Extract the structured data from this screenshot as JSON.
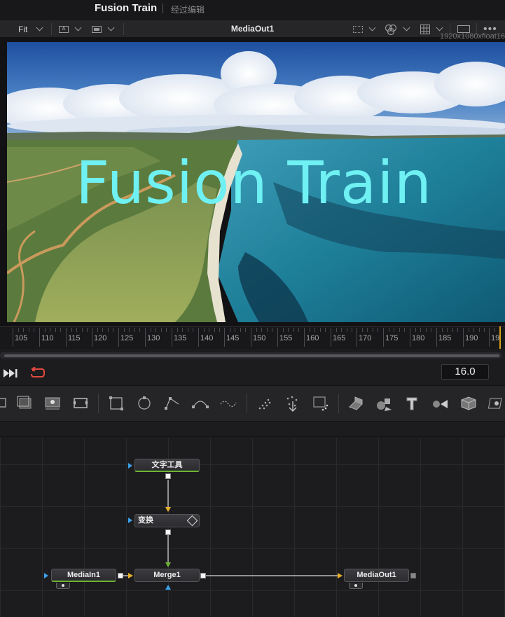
{
  "app": {
    "title": "Fusion Train",
    "subtitle": "经过编辑"
  },
  "viewer": {
    "zoom_label": "Fit",
    "title": "MediaOut1",
    "resolution": "1920x1080xfloat16",
    "overlay_text": "Fusion Train",
    "overlay_color": "#6ff0f2"
  },
  "timeline": {
    "tick_labels": [
      "105",
      "110",
      "115",
      "120",
      "125",
      "130",
      "135",
      "140",
      "145",
      "150",
      "155",
      "160",
      "165",
      "170",
      "175",
      "180",
      "185",
      "190",
      "19"
    ],
    "current_frame": "16.0",
    "playhead_color": "#d7a21c"
  },
  "toolbar": {
    "tools": [
      "merge-tool",
      "media-in-tool",
      "loader-tool",
      "transform-tool",
      "rectangle-mask-icon",
      "ellipse-mask-icon",
      "polygon-mask-icon",
      "bspline-mask-icon",
      "paint-icon",
      "particle-emitter-icon",
      "particle-render-icon",
      "particle-flow-icon",
      "shape-3d-icon",
      "merge-3d-icon",
      "text-3d-icon",
      "camera-3d-icon",
      "renderer-3d-icon",
      "image-plane-3d-icon"
    ]
  },
  "nodes": {
    "text": {
      "label": "文字工具"
    },
    "transform": {
      "label": "变换"
    },
    "mediain": {
      "label": "MediaIn1"
    },
    "merge": {
      "label": "Merge1"
    },
    "mediaout": {
      "label": "MediaOut1"
    }
  },
  "colors": {
    "node_green": "#6fb431",
    "port_yellow": "#e6b02a",
    "port_green": "#6fb431",
    "port_blue": "#3aa0e8"
  }
}
